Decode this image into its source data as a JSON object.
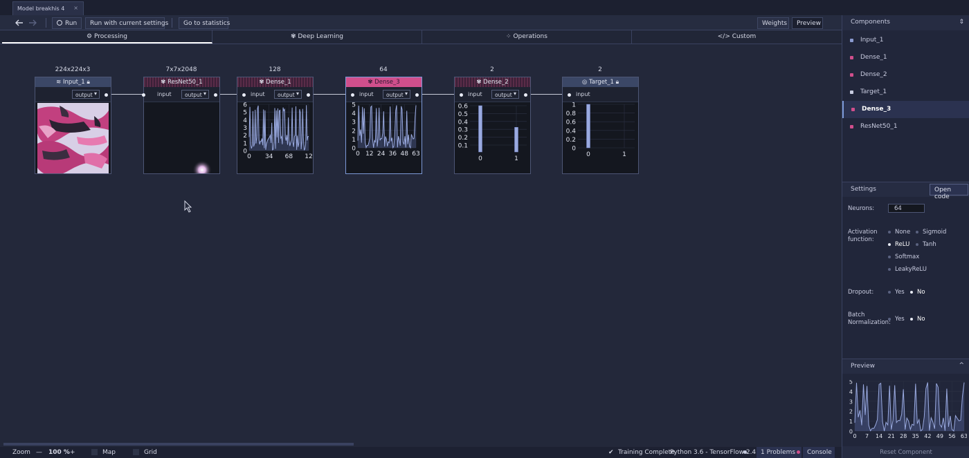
{
  "tab": {
    "title": "Model breakhis 4",
    "close": "×"
  },
  "toolbar": {
    "run": "Run",
    "run_current": "Run with current settings",
    "goto_stats": "Go to statistics",
    "weights": "Weights",
    "preview": "Preview"
  },
  "categories": [
    {
      "label": "Processing",
      "icon": "gear-icon"
    },
    {
      "label": "Deep Learning",
      "icon": "brain-icon"
    },
    {
      "label": "Operations",
      "icon": "grid-icon"
    },
    {
      "label": "Custom",
      "icon": "code-icon"
    }
  ],
  "nodes": [
    {
      "shape": "224x224x3",
      "title": "Input_1",
      "out": "output",
      "in": ""
    },
    {
      "shape": "7x7x2048",
      "title": "ResNet50_1",
      "out": "output",
      "in": "input"
    },
    {
      "shape": "128",
      "title": "Dense_1",
      "out": "output",
      "in": "input"
    },
    {
      "shape": "64",
      "title": "Dense_3",
      "out": "output",
      "in": "input"
    },
    {
      "shape": "2",
      "title": "Dense_2",
      "out": "output",
      "in": "input"
    },
    {
      "shape": "2",
      "title": "Target_1",
      "out": "",
      "in": "input"
    }
  ],
  "charts": {
    "dense1": {
      "type": "line",
      "yticks": [
        "6",
        "5",
        "4",
        "3",
        "2",
        "1",
        "0"
      ],
      "xticks": [
        "0",
        "34",
        "68",
        "12"
      ]
    },
    "dense3": {
      "type": "line",
      "yticks": [
        "5",
        "4",
        "3",
        "2",
        "1",
        "0"
      ],
      "xticks": [
        "0",
        "12",
        "24",
        "36",
        "48",
        "63"
      ]
    },
    "dense2": {
      "type": "bar",
      "yticks": [
        "0.6",
        "0.5",
        "0.4",
        "0.3",
        "0.2",
        "0.1"
      ],
      "xticks": [
        "0",
        "1"
      ],
      "values": [
        0.6,
        0.32
      ]
    },
    "target": {
      "type": "bar",
      "yticks": [
        "1",
        "0.8",
        "0.6",
        "0.4",
        "0.2",
        "0"
      ],
      "xticks": [
        "0",
        "1"
      ],
      "values": [
        1.0,
        0.0
      ]
    }
  },
  "chart_data": [
    {
      "type": "line",
      "title": "Dense_1",
      "x_range": [
        0,
        127
      ],
      "ylim": [
        0,
        6
      ]
    },
    {
      "type": "line",
      "title": "Dense_3",
      "x_range": [
        0,
        63
      ],
      "ylim": [
        0,
        5
      ]
    },
    {
      "type": "bar",
      "title": "Dense_2",
      "categories": [
        "0",
        "1"
      ],
      "values": [
        0.6,
        0.32
      ],
      "ylim": [
        0,
        0.6
      ]
    },
    {
      "type": "bar",
      "title": "Target_1",
      "categories": [
        "0",
        "1"
      ],
      "values": [
        1.0,
        0.0
      ],
      "ylim": [
        0,
        1
      ]
    },
    {
      "type": "line",
      "title": "Preview",
      "xticks": [
        "0",
        "7",
        "14",
        "21",
        "28",
        "35",
        "42",
        "49",
        "56",
        "63"
      ],
      "yticks": [
        "5",
        "4",
        "3",
        "2",
        "1",
        "0"
      ],
      "ylim": [
        0,
        5
      ]
    }
  ],
  "components": {
    "title": "Components",
    "items": [
      {
        "label": "Input_1",
        "color": "#8a9ad0"
      },
      {
        "label": "Dense_1",
        "color": "#d04f8c"
      },
      {
        "label": "Dense_2",
        "color": "#d04f8c"
      },
      {
        "label": "Target_1",
        "color": "#c8cce0"
      },
      {
        "label": "Dense_3",
        "color": "#d04f8c"
      },
      {
        "label": "ResNet50_1",
        "color": "#d04f8c"
      }
    ]
  },
  "settings": {
    "title": "Settings",
    "open_code": "Open code",
    "neurons_label": "Neurons:",
    "neurons_value": "64",
    "activation_label_1": "Activation",
    "activation_label_2": "function:",
    "act_none": "None",
    "act_sigmoid": "Sigmoid",
    "act_relu": "ReLU",
    "act_tanh": "Tanh",
    "act_softmax": "Softmax",
    "act_leaky": "LeakyReLU",
    "dropout_label": "Dropout:",
    "yes": "Yes",
    "no": "No",
    "batch_label_1": "Batch",
    "batch_label_2": "Normalization:"
  },
  "preview": {
    "title": "Preview",
    "reset": "Reset Component"
  },
  "status": {
    "zoom_label": "Zoom",
    "zoom_minus": "—",
    "zoom_value": "100 %",
    "zoom_plus": "+",
    "map": "Map",
    "grid": "Grid",
    "training": "Training Complete",
    "python": "Python 3.6 - TensorFlow 2.4.1",
    "problems": "1 Problems",
    "console": "Console"
  },
  "colors": {
    "accent": "#d04f8c",
    "line": "#8a9ad0",
    "panel": "#21263a"
  }
}
